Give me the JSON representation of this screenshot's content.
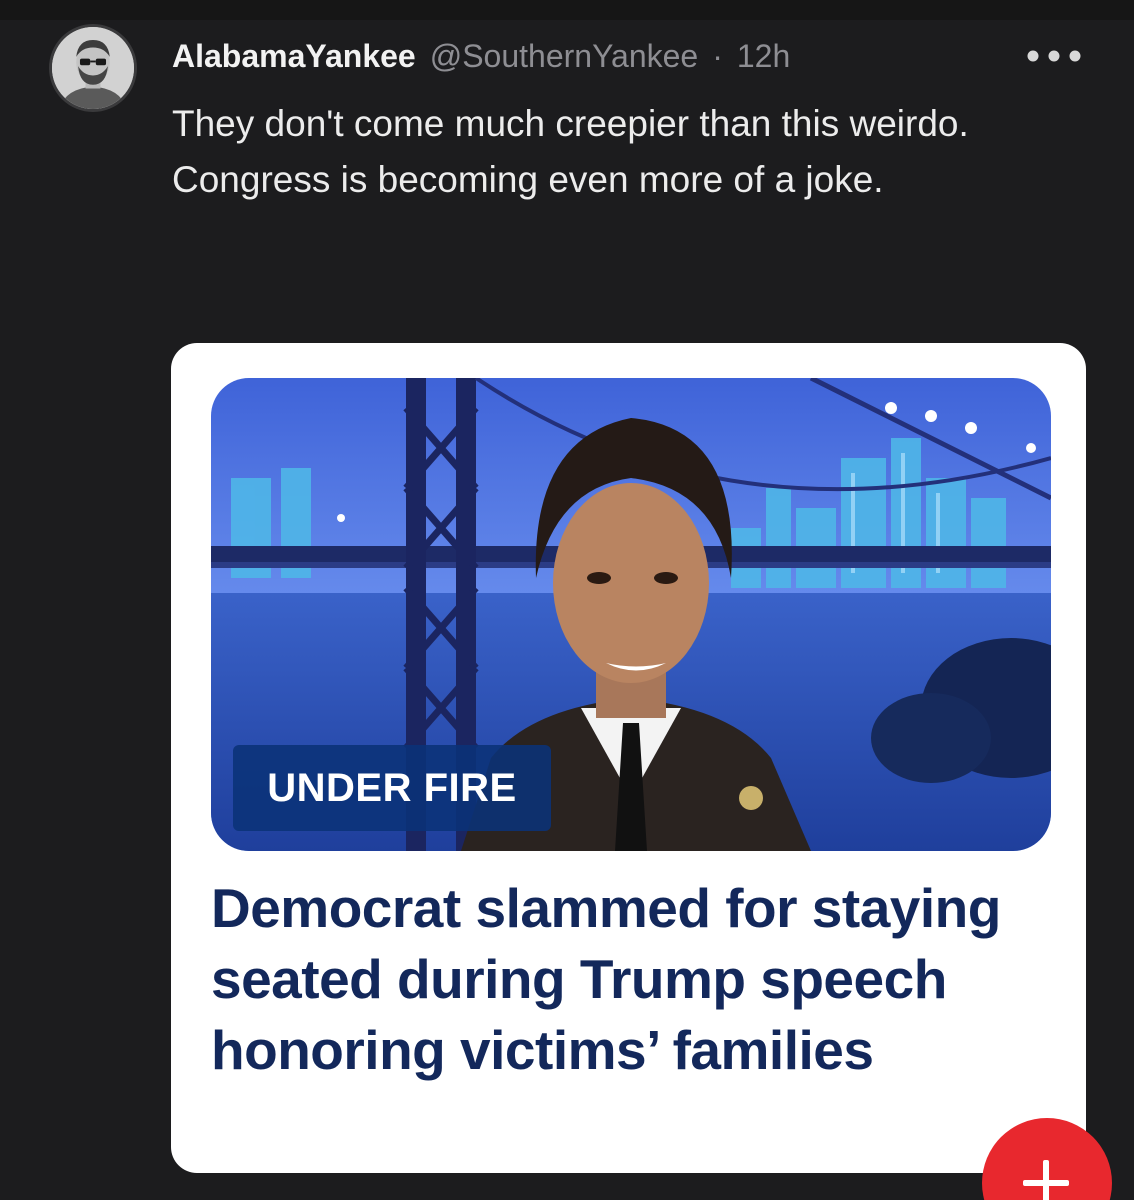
{
  "post": {
    "author": {
      "display_name": "AlabamaYankee",
      "handle": "@SouthernYankee",
      "separator": "·",
      "timestamp": "12h"
    },
    "text": "They don't come much creepier than this weirdo. Congress is becoming even more of a joke.",
    "menu_icon": "more-horizontal-icon"
  },
  "link_card": {
    "chyron": "UNDER FIRE",
    "headline": "Democrat slammed for staying seated during Trump speech honoring victims’ families",
    "headline_color": "#13285b"
  },
  "compose_button": {
    "icon": "plus-icon",
    "color": "#e8282e"
  }
}
